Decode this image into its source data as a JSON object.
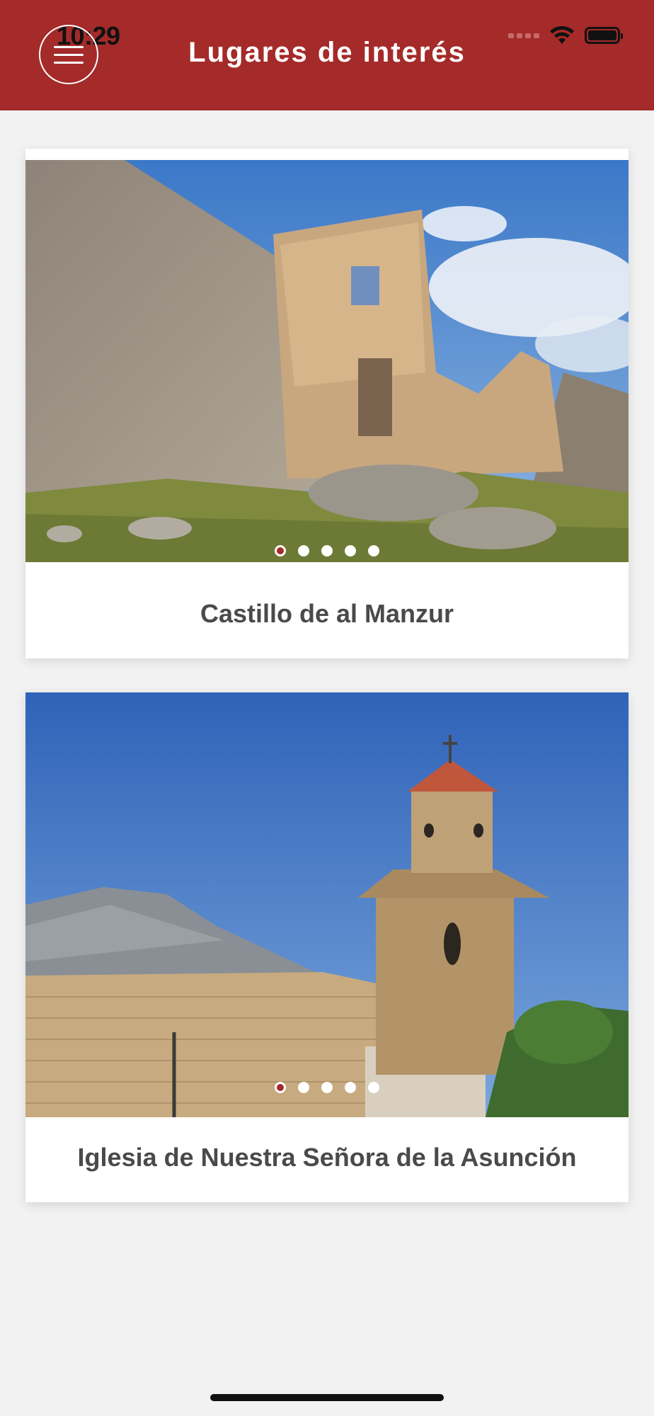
{
  "status_bar": {
    "time": "10:29"
  },
  "header": {
    "title": "Lugares de interés",
    "menu_icon": "hamburger-menu-icon"
  },
  "places": [
    {
      "title": "Castillo de al Manzur",
      "image": "castle-ruins-photo",
      "slides": 5,
      "active_slide": 1
    },
    {
      "title": "Iglesia de Nuestra Señora de la Asunción",
      "image": "church-bell-tower-photo",
      "slides": 5,
      "active_slide": 1
    }
  ],
  "colors": {
    "brand": "#a52a2a",
    "background": "#f2f2f2",
    "card": "#ffffff",
    "title_text": "#4a4a4a"
  }
}
